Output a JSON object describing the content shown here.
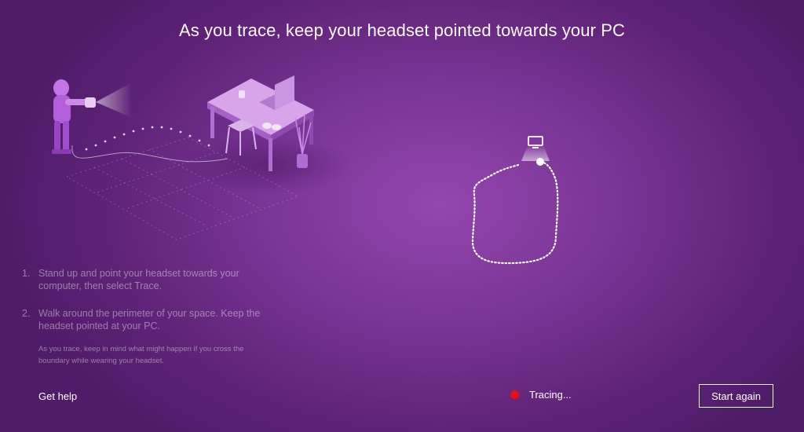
{
  "header": {
    "title": "As you trace, keep your headset pointed towards your PC"
  },
  "illustration": {
    "icon": "person-desk-boundary-illustration"
  },
  "trace_preview": {
    "pc_icon": "monitor-icon",
    "path_icon": "dotted-trace-path"
  },
  "instructions": {
    "steps": [
      {
        "number": "1.",
        "text": "Stand up and point your headset towards your computer, then select Trace."
      },
      {
        "number": "2.",
        "text": "Walk around the perimeter of your space. Keep the headset pointed at your PC."
      }
    ],
    "note": "As you trace, keep in mind what might happen if you cross the boundary while wearing your headset."
  },
  "footer": {
    "help_label": "Get help",
    "status_label": "Tracing...",
    "status_color": "#e4101c",
    "start_again_label": "Start again"
  },
  "colors": {
    "background": "#7a3595",
    "accent": "#ffffff"
  }
}
